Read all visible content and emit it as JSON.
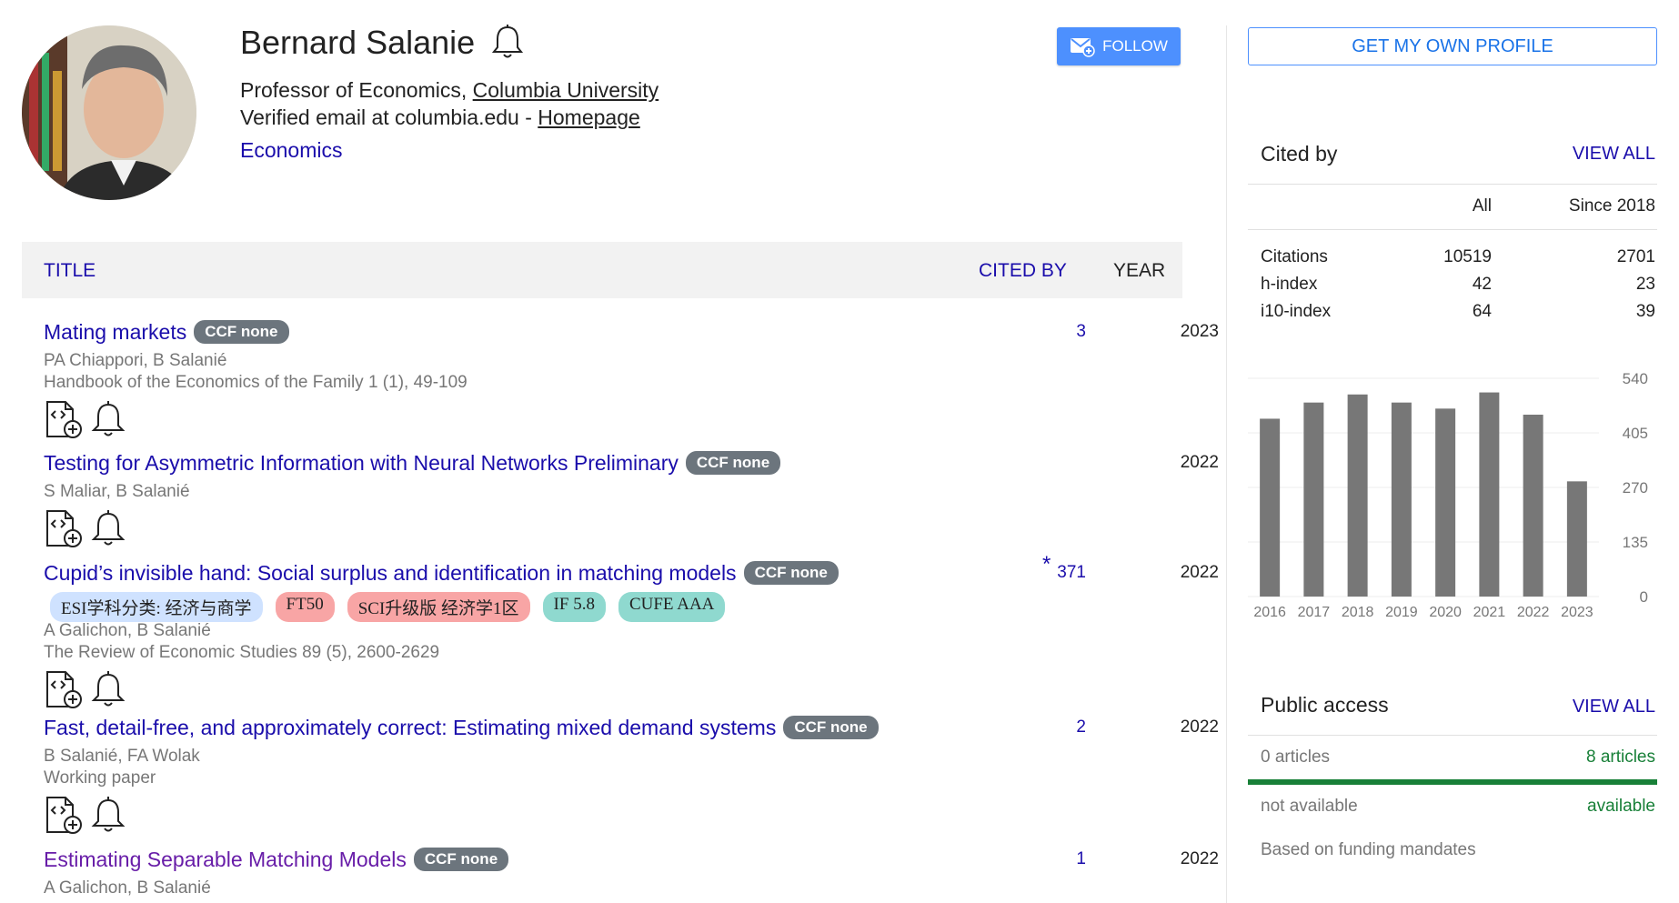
{
  "profile": {
    "name": "Bernard Salanie",
    "affiliation_prefix": "Professor of Economics, ",
    "affiliation_link": "Columbia University",
    "email_text": "Verified email at columbia.edu - ",
    "homepage_link": "Homepage",
    "interests": [
      "Economics"
    ],
    "follow_label": "FOLLOW"
  },
  "sidebar": {
    "get_profile_label": "GET MY OWN PROFILE",
    "cited_by": {
      "heading": "Cited by",
      "view_all": "VIEW ALL",
      "col_all": "All",
      "col_since": "Since 2018",
      "rows": [
        {
          "label": "Citations",
          "all": "10519",
          "since": "2701"
        },
        {
          "label": "h-index",
          "all": "42",
          "since": "23"
        },
        {
          "label": "i10-index",
          "all": "64",
          "since": "39"
        }
      ]
    },
    "public_access": {
      "heading": "Public access",
      "view_all": "VIEW ALL",
      "left_count": "0 articles",
      "right_count": "8 articles",
      "left_status": "not available",
      "right_status": "available",
      "note": "Based on funding mandates",
      "available_fraction": 1.0,
      "available_color": "#188038"
    }
  },
  "chart_data": {
    "type": "bar",
    "categories": [
      "2016",
      "2017",
      "2018",
      "2019",
      "2020",
      "2021",
      "2022",
      "2023"
    ],
    "values": [
      440,
      480,
      500,
      480,
      465,
      505,
      450,
      285
    ],
    "yticks": [
      "540",
      "405",
      "270",
      "135",
      "0"
    ],
    "ylim": [
      0,
      540
    ],
    "grid": true,
    "bar_color": "#777777"
  },
  "table": {
    "col_title": "TITLE",
    "col_cited": "CITED BY",
    "col_year": "YEAR"
  },
  "papers": [
    {
      "title": "Mating markets",
      "badge": "CCF none",
      "authors": "PA Chiappori, B Salanié",
      "venue": "Handbook of the Economics of the Family 1 (1), 49-109",
      "cited": "3",
      "year": "2023",
      "tags": []
    },
    {
      "title": "Testing for Asymmetric Information with Neural Networks Preliminary",
      "badge": "CCF none",
      "authors": "S Maliar, B Salanié",
      "venue": "",
      "cited": "",
      "year": "2022",
      "tags": []
    },
    {
      "title": "Cupid’s invisible hand: Social surplus and identification in matching models",
      "badge": "CCF none",
      "authors": "A Galichon, B Salanié",
      "venue": "The Review of Economic Studies 89 (5), 2600-2629",
      "cited": "371",
      "cited_mark": "*",
      "year": "2022",
      "tags": [
        {
          "label": "ESI学科分类: 经济与商学",
          "color": "#cfe2ff"
        },
        {
          "label": "FT50",
          "color": "#f8a5a5"
        },
        {
          "label": "SCI升级版 经济学1区",
          "color": "#f8a5a5"
        },
        {
          "label": "IF 5.8",
          "color": "#8fd9cf"
        },
        {
          "label": "CUFE AAA",
          "color": "#8fd9cf"
        }
      ]
    },
    {
      "title": "Fast, detail-free, and approximately correct: Estimating mixed demand systems",
      "badge": "CCF none",
      "authors": "B Salanié, FA Wolak",
      "venue": "Working paper",
      "cited": "2",
      "year": "2022",
      "tags": []
    },
    {
      "title": "Estimating Separable Matching Models",
      "badge": "CCF none",
      "authors": "A Galichon, B Salanié",
      "venue": "",
      "cited": "1",
      "year": "2022",
      "tags": [],
      "visited": true
    }
  ]
}
